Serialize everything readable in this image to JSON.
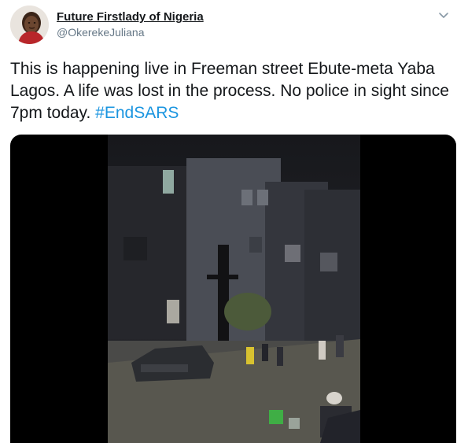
{
  "author": {
    "display_name": "Future Firstlady of Nigeria",
    "handle": "@OkerekeJuliana"
  },
  "tweet": {
    "text": "This is happening live in Freeman street Ebute-meta Yaba Lagos. A life was lost in the process. No police in sight since 7pm today. ",
    "hashtag": "#EndSARS"
  },
  "icons": {
    "menu": "chevron-down-icon",
    "avatar": "avatar"
  },
  "colors": {
    "link": "#1b95e0",
    "text": "#14171a",
    "secondary": "#657786",
    "media_letterbox": "#000000"
  }
}
